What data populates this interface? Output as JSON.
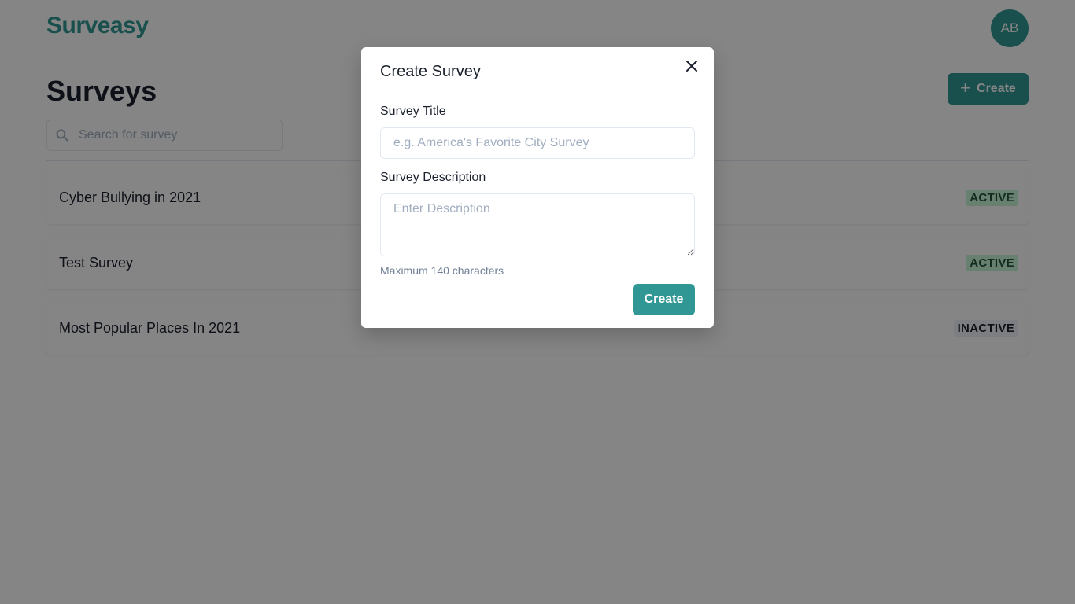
{
  "app": {
    "logo": "Surveasy",
    "avatar_initials": "AB",
    "accent_color": "#319795"
  },
  "main": {
    "title": "Surveys",
    "create_button": {
      "icon": "plus-icon",
      "label": "Create"
    },
    "search": {
      "icon": "search-icon",
      "placeholder": "Search for survey",
      "value": ""
    },
    "surveys": [
      {
        "title": "Cyber Bullying in 2021",
        "status": "ACTIVE"
      },
      {
        "title": "Test Survey",
        "status": "ACTIVE"
      },
      {
        "title": "Most Popular Places In 2021",
        "status": "INACTIVE"
      }
    ]
  },
  "modal": {
    "title": "Create Survey",
    "close_icon": "close-icon",
    "title_field": {
      "label": "Survey Title",
      "placeholder": "e.g. America's Favorite City Survey",
      "value": ""
    },
    "description_field": {
      "label": "Survey Description",
      "placeholder": "Enter Description",
      "value": ""
    },
    "helper_text": "Maximum 140 characters",
    "submit_label": "Create"
  }
}
